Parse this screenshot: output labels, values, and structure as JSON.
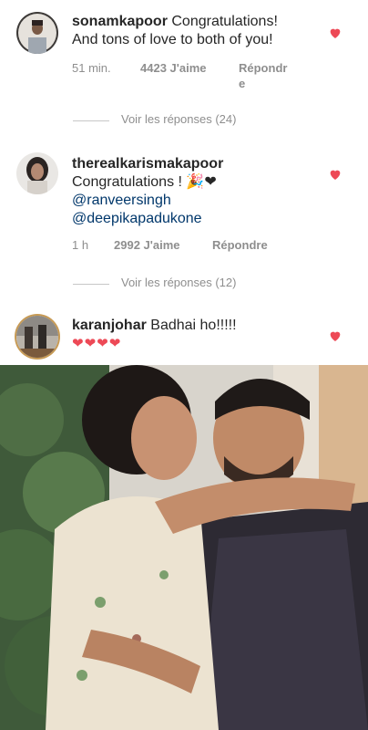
{
  "comments": [
    {
      "username": "sonamkapoor",
      "text": "Congratulations!",
      "text2": "And tons of love to both of you!",
      "time": "51 min.",
      "likes": "4423 J'aime",
      "reply_a": "Répondr",
      "reply_b": "e",
      "view_replies": "Voir les réponses (24)"
    },
    {
      "username": "therealkarismakapoor",
      "text": "Congratulations ! 🎉❤",
      "mention1": "@ranveersingh",
      "mention2": "@deepikapadukone",
      "time": "1 h",
      "likes": "2992 J'aime",
      "reply": "Répondre",
      "view_replies": "Voir les réponses (12)"
    },
    {
      "username": "karanjohar",
      "text": "Badhai ho!!!!!",
      "hearts": "❤❤❤❤"
    }
  ],
  "colors": {
    "heart": "#ed4956",
    "mention": "#00376b",
    "meta": "#8e8e8e"
  },
  "icons": [
    "heart-icon",
    "avatar"
  ]
}
